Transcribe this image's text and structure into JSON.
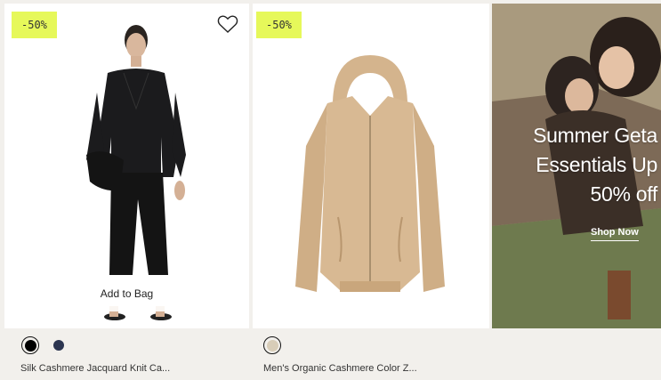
{
  "products": [
    {
      "badge": "-50%",
      "name": "Silk Cashmere Jacquard Knit Ca...",
      "add_to_bag": "Add to Bag",
      "swatches": [
        {
          "color": "#000000",
          "selected": true
        },
        {
          "color": "#2c3550",
          "selected": false
        }
      ]
    },
    {
      "badge": "-50%",
      "name": "Men's Organic Cashmere Color Z...",
      "swatches": [
        {
          "color": "#d8cdb8",
          "selected": true
        }
      ]
    }
  ],
  "promo": {
    "lines": [
      "Summer Geta",
      "Essentials Up",
      "50% off"
    ],
    "cta": "Shop Now"
  },
  "colors": {
    "badge_bg": "#e6f85a",
    "page_bg": "#f2f0ec"
  }
}
